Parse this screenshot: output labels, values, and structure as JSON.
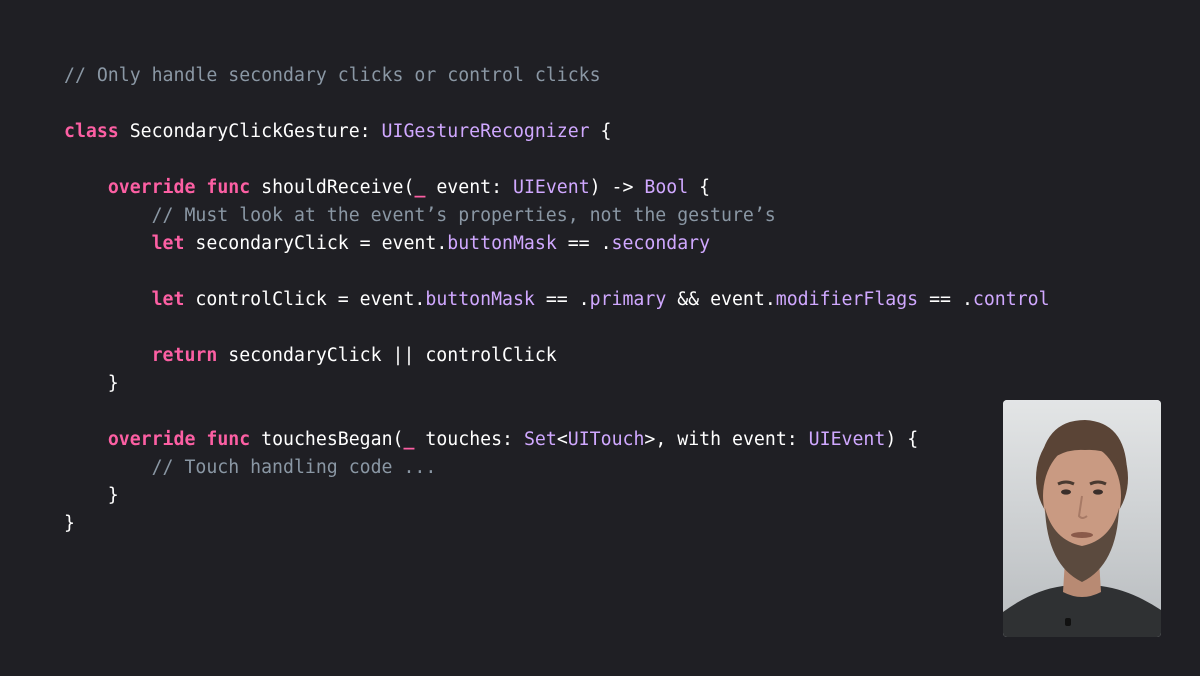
{
  "code": {
    "lines": [
      [
        {
          "t": "// Only handle secondary clicks or control clicks",
          "k": "comment"
        }
      ],
      [],
      [
        {
          "t": "class",
          "k": "kw"
        },
        {
          "t": " SecondaryClickGesture: ",
          "k": "plain"
        },
        {
          "t": "UIGestureRecognizer",
          "k": "type"
        },
        {
          "t": " {",
          "k": "plain"
        }
      ],
      [],
      [
        {
          "t": "    ",
          "k": "plain"
        },
        {
          "t": "override",
          "k": "kw"
        },
        {
          "t": " ",
          "k": "plain"
        },
        {
          "t": "func",
          "k": "kw"
        },
        {
          "t": " shouldReceive(",
          "k": "plain"
        },
        {
          "t": "_",
          "k": "kw"
        },
        {
          "t": " event: ",
          "k": "plain"
        },
        {
          "t": "UIEvent",
          "k": "type"
        },
        {
          "t": ") -> ",
          "k": "plain"
        },
        {
          "t": "Bool",
          "k": "type"
        },
        {
          "t": " {",
          "k": "plain"
        }
      ],
      [
        {
          "t": "        // Must look at the event’s properties, not the gesture’s",
          "k": "comment"
        }
      ],
      [
        {
          "t": "        ",
          "k": "plain"
        },
        {
          "t": "let",
          "k": "kw"
        },
        {
          "t": " secondaryClick = event.",
          "k": "plain"
        },
        {
          "t": "buttonMask",
          "k": "prop"
        },
        {
          "t": " == .",
          "k": "plain"
        },
        {
          "t": "secondary",
          "k": "prop"
        }
      ],
      [],
      [
        {
          "t": "        ",
          "k": "plain"
        },
        {
          "t": "let",
          "k": "kw"
        },
        {
          "t": " controlClick = event.",
          "k": "plain"
        },
        {
          "t": "buttonMask",
          "k": "prop"
        },
        {
          "t": " == .",
          "k": "plain"
        },
        {
          "t": "primary",
          "k": "prop"
        },
        {
          "t": " && event.",
          "k": "plain"
        },
        {
          "t": "modifierFlags",
          "k": "prop"
        },
        {
          "t": " == .",
          "k": "plain"
        },
        {
          "t": "control",
          "k": "prop"
        }
      ],
      [],
      [
        {
          "t": "        ",
          "k": "plain"
        },
        {
          "t": "return",
          "k": "kw"
        },
        {
          "t": " secondaryClick || controlClick",
          "k": "plain"
        }
      ],
      [
        {
          "t": "    }",
          "k": "plain"
        }
      ],
      [],
      [
        {
          "t": "    ",
          "k": "plain"
        },
        {
          "t": "override",
          "k": "kw"
        },
        {
          "t": " ",
          "k": "plain"
        },
        {
          "t": "func",
          "k": "kw"
        },
        {
          "t": " touchesBegan(",
          "k": "plain"
        },
        {
          "t": "_",
          "k": "kw"
        },
        {
          "t": " touches: ",
          "k": "plain"
        },
        {
          "t": "Set",
          "k": "type"
        },
        {
          "t": "<",
          "k": "plain"
        },
        {
          "t": "UITouch",
          "k": "type"
        },
        {
          "t": ">, with event: ",
          "k": "plain"
        },
        {
          "t": "UIEvent",
          "k": "type"
        },
        {
          "t": ") {",
          "k": "plain"
        }
      ],
      [
        {
          "t": "        // Touch handling code ...",
          "k": "comment"
        }
      ],
      [
        {
          "t": "    }",
          "k": "plain"
        }
      ],
      [
        {
          "t": "}",
          "k": "plain"
        }
      ]
    ]
  },
  "presenter": {
    "icon": "presenter-video"
  },
  "colors": {
    "background": "#1f1f24",
    "keyword": "#fc5fa3",
    "type": "#d0a8ff",
    "comment": "#8a97a4",
    "plain": "#ffffff"
  }
}
